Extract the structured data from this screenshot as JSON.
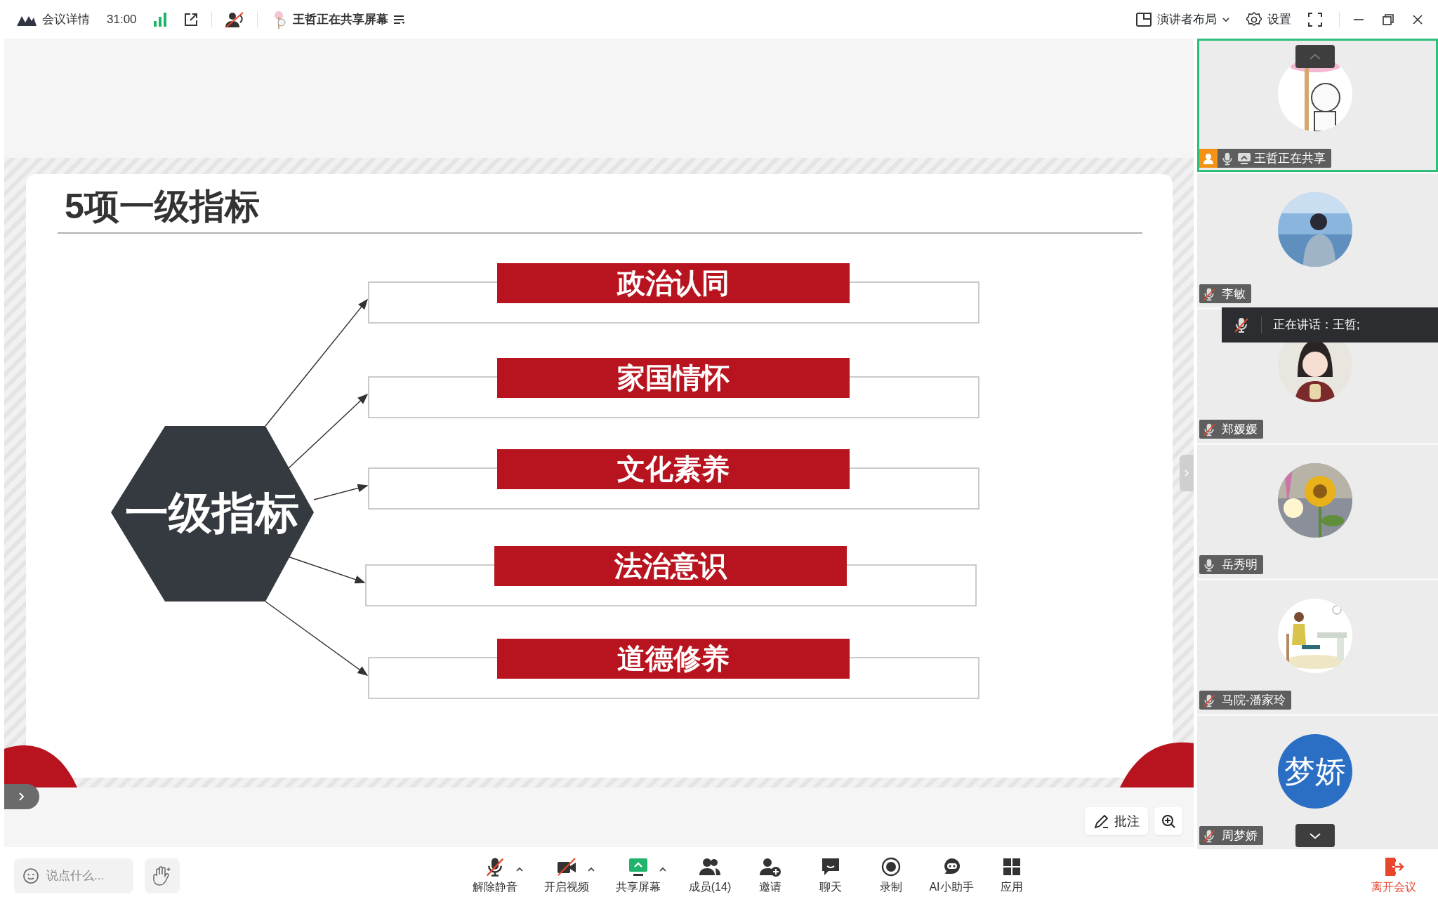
{
  "topbar": {
    "meeting_info": "会议详情",
    "duration": "31:00",
    "sharing_status": "王哲正在共享屏幕",
    "layout": "演讲者布局",
    "settings": "设置"
  },
  "slide": {
    "title": "5项一级指标",
    "center": "一级指标",
    "indicators": [
      "政治认同",
      "家国情怀",
      "文化素养",
      "法治意识",
      "道德修养"
    ]
  },
  "annotate_button": "批注",
  "participants": [
    {
      "name": "王哲正在共享",
      "selected": true,
      "host": true,
      "sharing": true,
      "muted": false
    },
    {
      "name": "李敏",
      "selected": false,
      "host": false,
      "sharing": false,
      "muted": true
    },
    {
      "name": "郑媛媛",
      "selected": false,
      "host": false,
      "sharing": false,
      "muted": true
    },
    {
      "name": "岳秀明",
      "selected": false,
      "host": false,
      "sharing": false,
      "muted": false
    },
    {
      "name": "马院-潘家玲",
      "selected": false,
      "host": false,
      "sharing": false,
      "muted": true
    },
    {
      "name": "周梦娇",
      "selected": false,
      "host": false,
      "sharing": false,
      "muted": true,
      "avatar": {
        "kind": "text",
        "text": "梦娇",
        "color": "#2b6fc4"
      }
    }
  ],
  "speaking": {
    "label": "正在讲话：王哲;"
  },
  "chat_input": {
    "placeholder": "说点什么..."
  },
  "toolbar": [
    {
      "label": "解除静音",
      "menu": true
    },
    {
      "label": "开启视频",
      "menu": true
    },
    {
      "label": "共享屏幕",
      "menu": true
    },
    {
      "label": "成员(14)",
      "menu": false
    },
    {
      "label": "邀请",
      "menu": false
    },
    {
      "label": "聊天",
      "menu": false
    },
    {
      "label": "录制",
      "menu": false
    },
    {
      "label": "AI小助手",
      "menu": false
    },
    {
      "label": "应用",
      "menu": false
    }
  ],
  "leave": "离开会议"
}
